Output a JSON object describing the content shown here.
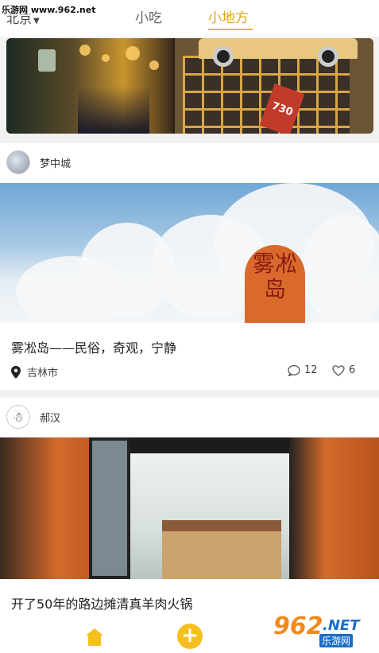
{
  "watermark": {
    "text": "乐游网 www.962.net"
  },
  "header": {
    "city": "北京",
    "tabs": [
      {
        "label": "小吃",
        "active": false
      },
      {
        "label": "小地方",
        "active": true
      }
    ],
    "accent_color": "#f1b61b"
  },
  "posts": [
    {
      "author": "梦中城",
      "title": "雾凇岛——民俗，奇观，宁静",
      "location": "吉林市",
      "comments": "12",
      "likes": "6",
      "photo_text": "雾凇岛"
    },
    {
      "author": "郝汉",
      "title": "开了50年的路边摊清真羊肉火锅"
    }
  ],
  "bottom_nav": {
    "home_icon": "home-icon",
    "add_icon": "plus-circle-icon",
    "add_glyph": "+"
  },
  "logo": {
    "num": "962",
    "net": ".NET",
    "sub": "乐游网"
  }
}
